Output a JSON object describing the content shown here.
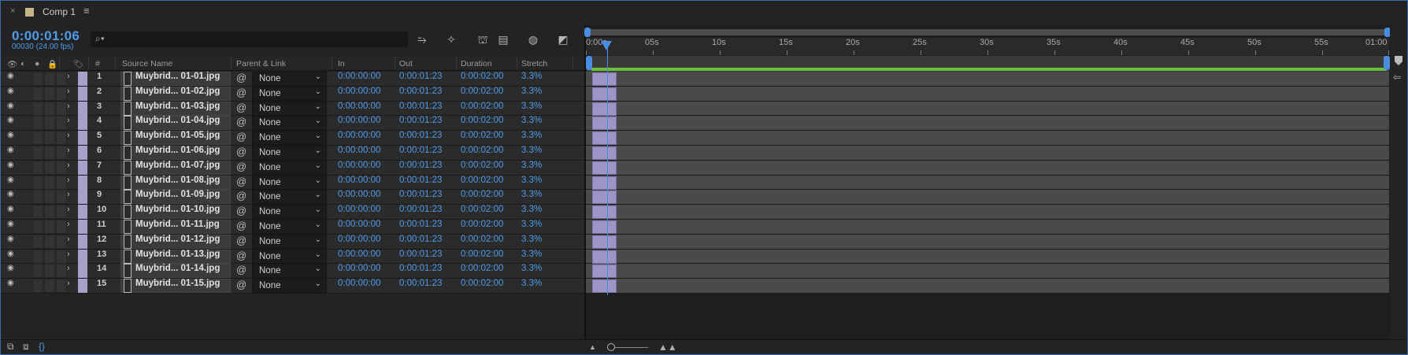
{
  "comp": {
    "tab_title": "Comp 1",
    "menu_icon": "hamburger-icon"
  },
  "time": {
    "timecode": "0:00:01:06",
    "frames": "00030 (24.00 fps)"
  },
  "search": {
    "placeholder": "",
    "icon": "search-icon"
  },
  "toolbar_icons": [
    "shy-layers-icon",
    "draft-3d-icon",
    "frame-blending-icon",
    "motion-blur-icon",
    "graph-editor-icon",
    "comp-flowchart-icon"
  ],
  "columns": {
    "label": "",
    "index": "#",
    "source": "Source Name",
    "parent": "Parent & Link",
    "in": "In",
    "out": "Out",
    "duration": "Duration",
    "stretch": "Stretch"
  },
  "layers": [
    {
      "index": "1",
      "name": "Muybrid... 01-01.jpg",
      "parent": "None",
      "in": "0:00:00:00",
      "out": "0:00:01:23",
      "duration": "0:00:02:00",
      "stretch": "3.3%"
    },
    {
      "index": "2",
      "name": "Muybrid... 01-02.jpg",
      "parent": "None",
      "in": "0:00:00:00",
      "out": "0:00:01:23",
      "duration": "0:00:02:00",
      "stretch": "3.3%"
    },
    {
      "index": "3",
      "name": "Muybrid... 01-03.jpg",
      "parent": "None",
      "in": "0:00:00:00",
      "out": "0:00:01:23",
      "duration": "0:00:02:00",
      "stretch": "3.3%"
    },
    {
      "index": "4",
      "name": "Muybrid... 01-04.jpg",
      "parent": "None",
      "in": "0:00:00:00",
      "out": "0:00:01:23",
      "duration": "0:00:02:00",
      "stretch": "3.3%"
    },
    {
      "index": "5",
      "name": "Muybrid... 01-05.jpg",
      "parent": "None",
      "in": "0:00:00:00",
      "out": "0:00:01:23",
      "duration": "0:00:02:00",
      "stretch": "3.3%"
    },
    {
      "index": "6",
      "name": "Muybrid... 01-06.jpg",
      "parent": "None",
      "in": "0:00:00:00",
      "out": "0:00:01:23",
      "duration": "0:00:02:00",
      "stretch": "3.3%"
    },
    {
      "index": "7",
      "name": "Muybrid... 01-07.jpg",
      "parent": "None",
      "in": "0:00:00:00",
      "out": "0:00:01:23",
      "duration": "0:00:02:00",
      "stretch": "3.3%"
    },
    {
      "index": "8",
      "name": "Muybrid... 01-08.jpg",
      "parent": "None",
      "in": "0:00:00:00",
      "out": "0:00:01:23",
      "duration": "0:00:02:00",
      "stretch": "3.3%"
    },
    {
      "index": "9",
      "name": "Muybrid... 01-09.jpg",
      "parent": "None",
      "in": "0:00:00:00",
      "out": "0:00:01:23",
      "duration": "0:00:02:00",
      "stretch": "3.3%"
    },
    {
      "index": "10",
      "name": "Muybrid... 01-10.jpg",
      "parent": "None",
      "in": "0:00:00:00",
      "out": "0:00:01:23",
      "duration": "0:00:02:00",
      "stretch": "3.3%"
    },
    {
      "index": "11",
      "name": "Muybrid... 01-11.jpg",
      "parent": "None",
      "in": "0:00:00:00",
      "out": "0:00:01:23",
      "duration": "0:00:02:00",
      "stretch": "3.3%"
    },
    {
      "index": "12",
      "name": "Muybrid... 01-12.jpg",
      "parent": "None",
      "in": "0:00:00:00",
      "out": "0:00:01:23",
      "duration": "0:00:02:00",
      "stretch": "3.3%"
    },
    {
      "index": "13",
      "name": "Muybrid... 01-13.jpg",
      "parent": "None",
      "in": "0:00:00:00",
      "out": "0:00:01:23",
      "duration": "0:00:02:00",
      "stretch": "3.3%"
    },
    {
      "index": "14",
      "name": "Muybrid... 01-14.jpg",
      "parent": "None",
      "in": "0:00:00:00",
      "out": "0:00:01:23",
      "duration": "0:00:02:00",
      "stretch": "3.3%"
    },
    {
      "index": "15",
      "name": "Muybrid... 01-15.jpg",
      "parent": "None",
      "in": "0:00:00:00",
      "out": "0:00:01:23",
      "duration": "0:00:02:00",
      "stretch": "3.3%"
    }
  ],
  "ruler": {
    "labels": [
      "0:00s",
      "05s",
      "10s",
      "15s",
      "20s",
      "25s",
      "30s",
      "35s",
      "40s",
      "45s",
      "50s",
      "55s",
      "01:00"
    ]
  },
  "colors": {
    "accent": "#4a8de0",
    "timecode": "#4e9bea",
    "label": "#a7a0c8",
    "workarea": "#6bbf3a",
    "clip": "#9c95c5"
  }
}
